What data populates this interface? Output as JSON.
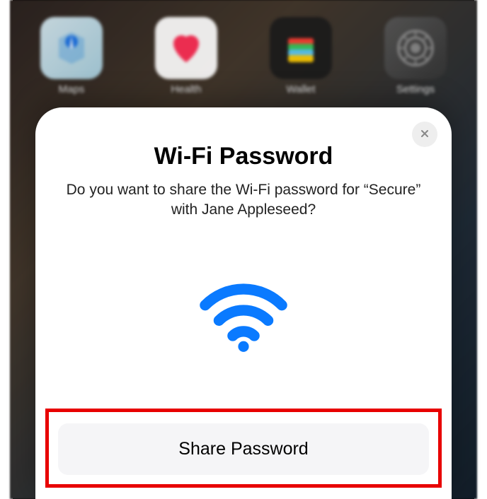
{
  "apps": {
    "maps": {
      "label": "Maps"
    },
    "health": {
      "label": "Health"
    },
    "wallet": {
      "label": "Wallet"
    },
    "settings": {
      "label": "Settings"
    }
  },
  "modal": {
    "title": "Wi-Fi Password",
    "subtitle": "Do you want to share the Wi-Fi password for “Secure” with Jane Appleseed?",
    "share_button": "Share Password"
  },
  "colors": {
    "wifi_icon": "#0a7aff",
    "highlight": "#e80000"
  }
}
